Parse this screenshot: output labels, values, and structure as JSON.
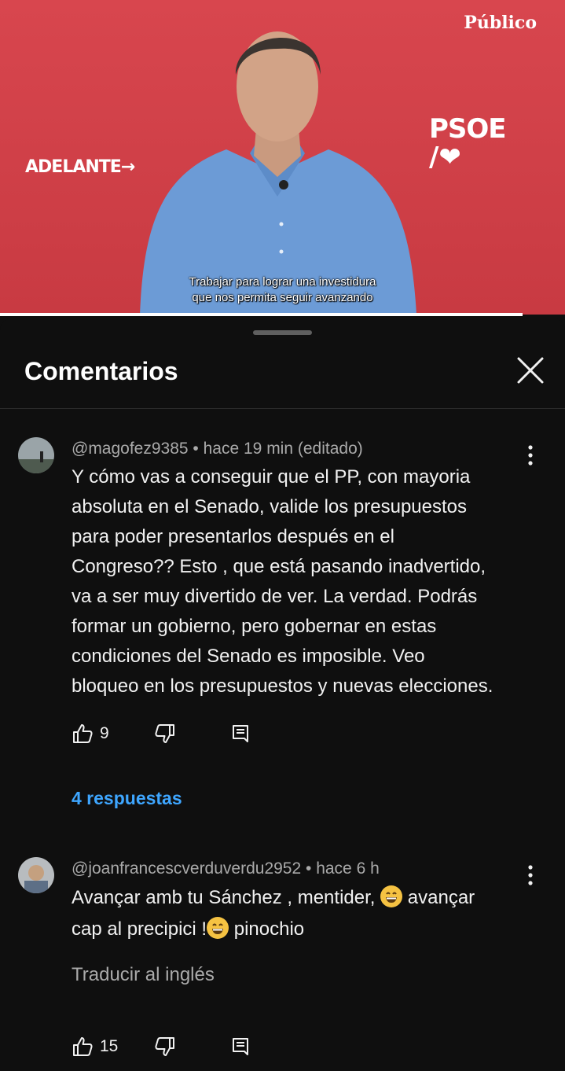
{
  "video": {
    "brand": "Público",
    "slogan": "ADELANTE→",
    "party_name": "PSOE",
    "party_mark": "/❤",
    "caption_line1": "Trabajar para lograr una investidura",
    "caption_line2": "que nos permita seguir avanzando",
    "progress_fraction": 0.925
  },
  "panel": {
    "title": "Comentarios",
    "close_icon": "close-icon"
  },
  "comments": [
    {
      "author": "@magofez9385",
      "time": "hace 19 min (editado)",
      "lines": [
        "Y cómo vas a conseguir que el PP, con mayoria",
        "absoluta en el Senado, valide los presupuestos",
        "para poder presentarlos después en el",
        "Congreso?? Esto , que está pasando inadvertido,",
        "va a ser muy divertido de ver. La verdad. Podrás",
        "formar un gobierno, pero gobernar en estas",
        "condiciones del Senado es imposible. Veo",
        "bloqueo en los presupuestos y nuevas elecciones."
      ],
      "likes": "9",
      "replies": "4 respuestas"
    },
    {
      "author": "@joanfrancescverduverdu2952",
      "time": "hace 6 h",
      "line1_a": "Avançar amb tu Sánchez , mentider,",
      "line1_b": "avançar",
      "line2_a": "cap al precipici !",
      "line2_b": "pinochio",
      "translate": "Traducir al inglés",
      "likes": "15"
    }
  ],
  "colors": {
    "background": "#0f0f0f",
    "video_red": "#d8464e",
    "link_blue": "#3ea6ff",
    "meta_gray": "#aaaaaa"
  }
}
